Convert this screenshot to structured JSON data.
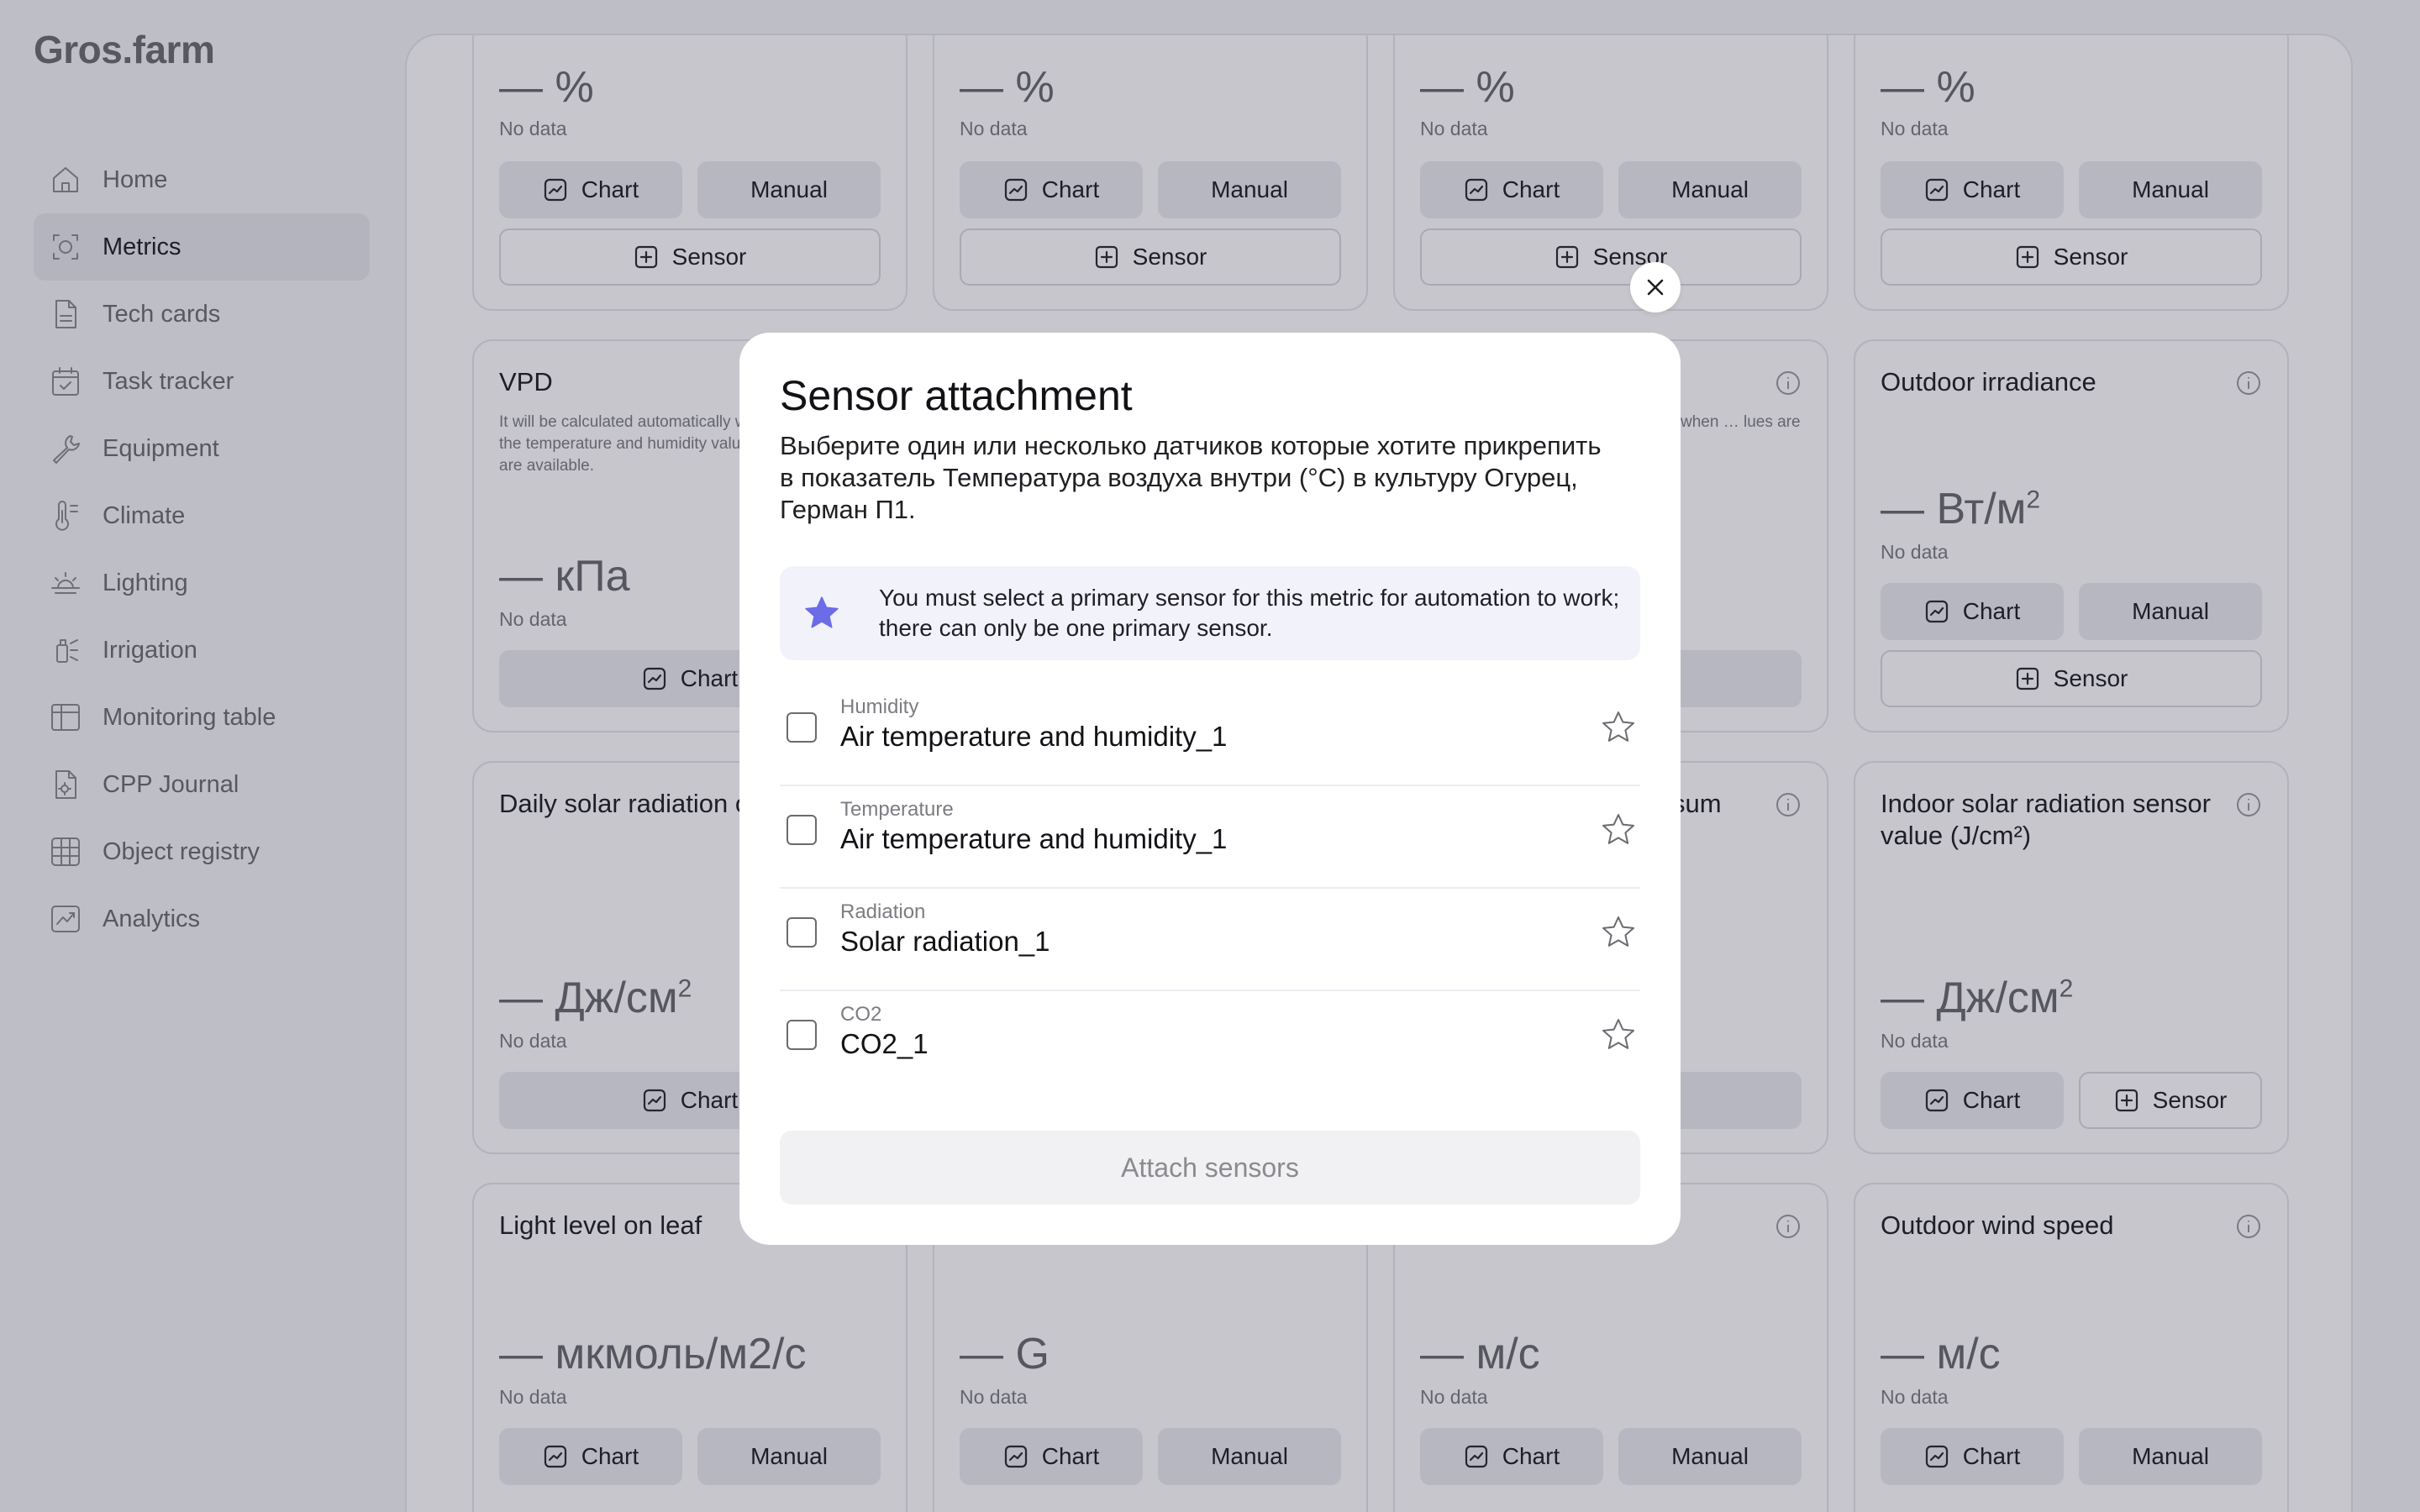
{
  "app": {
    "logo": "Gros.farm"
  },
  "sidebar": {
    "items": [
      {
        "label": "Home",
        "icon": "home-icon"
      },
      {
        "label": "Metrics",
        "icon": "metrics-icon",
        "active": true
      },
      {
        "label": "Tech cards",
        "icon": "tech-cards-icon"
      },
      {
        "label": "Task tracker",
        "icon": "task-tracker-icon"
      },
      {
        "label": "Equipment",
        "icon": "wrench-icon"
      },
      {
        "label": "Climate",
        "icon": "thermometer-icon"
      },
      {
        "label": "Lighting",
        "icon": "sunrise-icon"
      },
      {
        "label": "Irrigation",
        "icon": "sprinkler-icon"
      },
      {
        "label": "Monitoring table",
        "icon": "table-icon"
      },
      {
        "label": "CPP Journal",
        "icon": "journal-icon"
      },
      {
        "label": "Object registry",
        "icon": "grid-icon"
      },
      {
        "label": "Analytics",
        "icon": "analytics-icon"
      }
    ]
  },
  "labels": {
    "no_data": "No data",
    "chart": "Chart",
    "manual": "Manual",
    "sensor": "Sensor"
  },
  "cards": {
    "r1c1": {
      "value": "— %"
    },
    "r1c2": {
      "value": "— %"
    },
    "r1c3": {
      "value": "— %"
    },
    "r1c4": {
      "value": "— %"
    },
    "vpd": {
      "title": "VPD",
      "desc": "It will be calculated automatically when the temperature and humidity values are available.",
      "value": "— кПа"
    },
    "r2c3": {
      "desc": "when … lues are"
    },
    "outdoor_irradiance": {
      "title": "Outdoor irradiance",
      "value": "— Вт/м",
      "sup": "2"
    },
    "daily_solar": {
      "title": "Daily solar radiation outdoors",
      "value": "— Дж/см",
      "sup": "2"
    },
    "r3c3": {
      "title_fragment": "sum"
    },
    "indoor_solar": {
      "title": "Indoor solar radiation sensor value (J/cm²)",
      "value": "— Дж/см",
      "sup": "2"
    },
    "light_leaf": {
      "title": "Light level on leaf",
      "value": "— мкмоль/м2/с"
    },
    "r4c2": {
      "value": "— G"
    },
    "r4c3": {
      "value": "— м/с"
    },
    "outdoor_wind": {
      "title": "Outdoor wind speed",
      "value": "— м/с"
    }
  },
  "modal": {
    "title": "Sensor attachment",
    "description": "Выберите один или несколько датчиков которые хотите прикрепить в показатель  Температура воздуха внутри (°С) в культуру Огурец, Герман П1.",
    "notice": "You must select a primary sensor for this metric for automation to work; there can only be one primary sensor.",
    "notice_icon": "star-icon",
    "notice_color": "#6b6ce6",
    "sensors": [
      {
        "category": "Humidity",
        "name": "Air temperature and humidity_1",
        "checked": false,
        "primary": false
      },
      {
        "category": "Temperature",
        "name": "Air temperature and humidity_1",
        "checked": false,
        "primary": false
      },
      {
        "category": "Radiation",
        "name": "Solar radiation_1",
        "checked": false,
        "primary": false
      },
      {
        "category": "CO2",
        "name": "CO2_1",
        "checked": false,
        "primary": false
      }
    ],
    "attach_label": "Attach sensors"
  }
}
